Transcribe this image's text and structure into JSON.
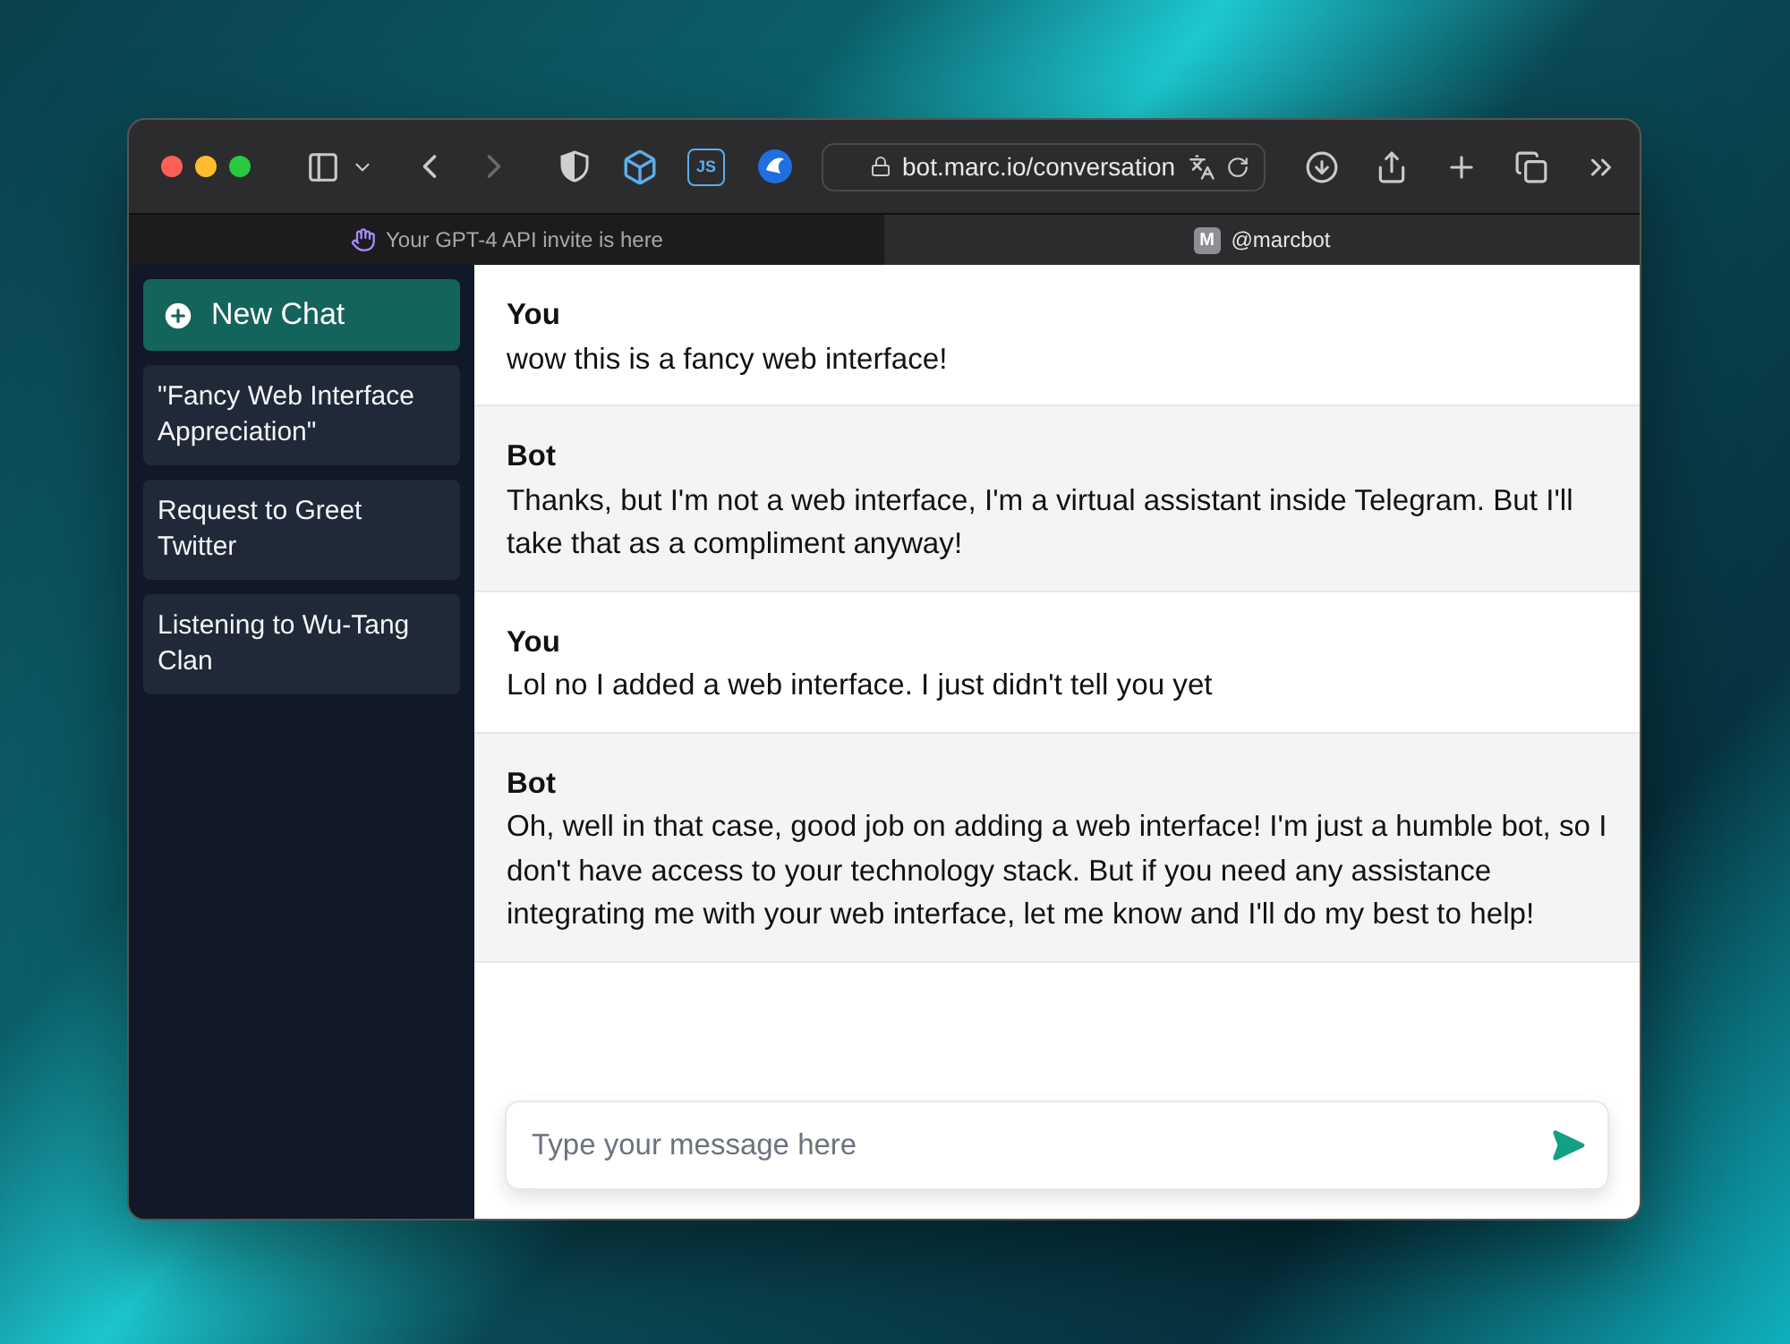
{
  "browser": {
    "url": "bot.marc.io/conversation",
    "extension_label": "JS",
    "tabs": [
      {
        "title": "Your GPT-4 API invite is here",
        "kind": "hand",
        "selected": false
      },
      {
        "title": "@marcbot",
        "kind": "avatar",
        "avatar_letter": "M",
        "selected": true
      }
    ]
  },
  "sidebar": {
    "new_chat": "New Chat",
    "conversations": [
      "\"Fancy Web Interface Appreciation\"",
      "Request to Greet Twitter",
      "Listening to Wu-Tang Clan"
    ]
  },
  "messages": [
    {
      "author": "You",
      "kind": "user",
      "text": "wow this is a fancy web interface!"
    },
    {
      "author": "Bot",
      "kind": "bot",
      "text": "Thanks, but I'm not a web interface, I'm a virtual assistant inside Telegram. But I'll take that as a compliment anyway!"
    },
    {
      "author": "You",
      "kind": "user",
      "text": "Lol no I added a web interface. I just didn't tell you yet"
    },
    {
      "author": "Bot",
      "kind": "bot",
      "text": "Oh, well in that case, good job on adding a web interface! I'm just a humble bot, so I don't have access to your technology stack. But if you need any assistance integrating me with your web interface, let me know and I'll do my best to help!"
    }
  ],
  "composer": {
    "placeholder": "Type your message here"
  }
}
